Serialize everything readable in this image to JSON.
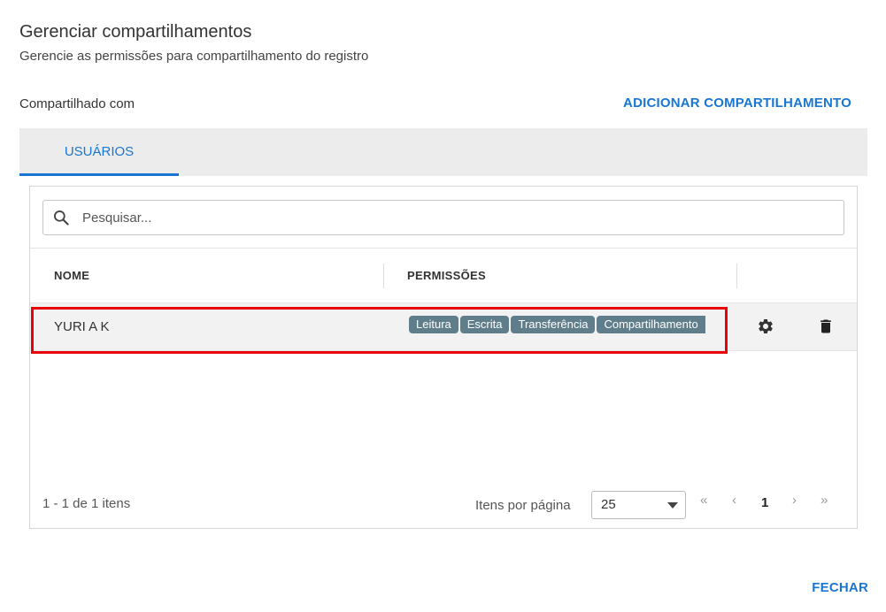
{
  "dialog": {
    "title": "Gerenciar compartilhamentos",
    "subtitle": "Gerencie as permissões para compartilhamento do registro",
    "shared_label": "Compartilhado com",
    "add_share_label": "ADICIONAR COMPARTILHAMENTO",
    "close_label": "FECHAR",
    "accent_color": "#1976d2"
  },
  "tabs": [
    {
      "label": "USUÁRIOS",
      "active": true
    }
  ],
  "search": {
    "placeholder": "Pesquisar...",
    "value": "",
    "icon": "search-icon"
  },
  "table": {
    "columns": [
      "NOME",
      "PERMISSÕES"
    ],
    "rows": [
      {
        "name": "YURI A K",
        "permissions": [
          "Leitura",
          "Escrita",
          "Transferência",
          "Compartilhamento"
        ],
        "actions": [
          "gear-icon",
          "trash-icon"
        ],
        "highlighted": true
      }
    ]
  },
  "pagination": {
    "count_text": "1 - 1 de 1 itens",
    "per_page_label": "Itens por página",
    "per_page_value": "25",
    "first": "«",
    "prev": "‹",
    "current_page": "1",
    "next": "›",
    "last": "»"
  },
  "colors": {
    "chip": "#607d8b",
    "highlight": "#e8000b",
    "tabbar": "#ececec"
  }
}
